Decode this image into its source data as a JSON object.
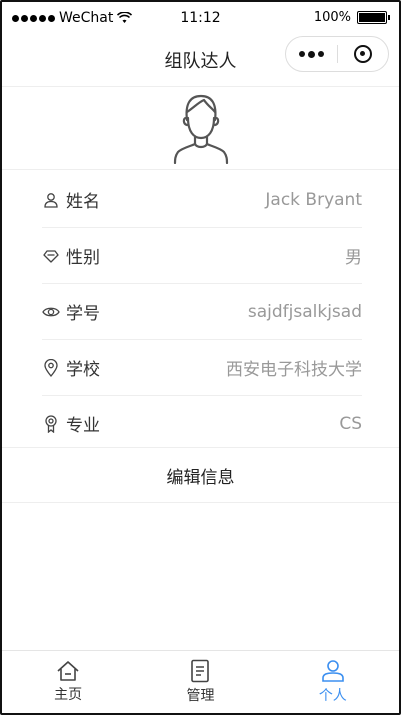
{
  "status_bar": {
    "carrier": "WeChat",
    "time": "11:12",
    "battery": "100%"
  },
  "nav": {
    "title": "组队达人"
  },
  "profile": {
    "rows": [
      {
        "label": "姓名",
        "value": "Jack Bryant",
        "icon": "user-icon"
      },
      {
        "label": "性别",
        "value": "男",
        "icon": "diamond-icon"
      },
      {
        "label": "学号",
        "value": "sajdfjsalkjsad",
        "icon": "eye-icon"
      },
      {
        "label": "学校",
        "value": "西安电子科技大学",
        "icon": "location-pin-icon"
      },
      {
        "label": "专业",
        "value": "CS",
        "icon": "award-icon"
      }
    ],
    "edit_label": "编辑信息"
  },
  "tabbar": {
    "tabs": [
      {
        "label": "主页",
        "icon": "home-icon",
        "active": false
      },
      {
        "label": "管理",
        "icon": "document-icon",
        "active": false
      },
      {
        "label": "个人",
        "icon": "person-icon",
        "active": true
      }
    ]
  },
  "colors": {
    "accent": "#3b8ff0",
    "text": "#333333",
    "muted": "#999999"
  }
}
